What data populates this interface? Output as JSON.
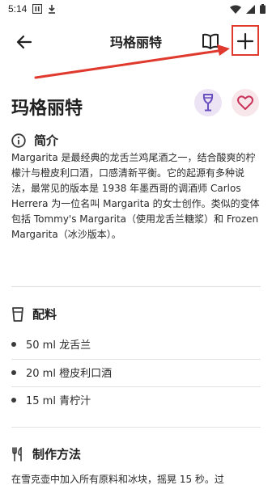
{
  "status_bar": {
    "time": "5:14"
  },
  "app_bar": {
    "title": "玛格丽特"
  },
  "header": {
    "name": "玛格丽特"
  },
  "intro": {
    "title": "简介",
    "text": "Margarita 是最经典的龙舌兰鸡尾酒之一，结合酸爽的柠檬汁与橙皮利口酒，口感清新平衡。它的起源有多种说法，最常见的版本是 1938 年墨西哥的调酒师 Carlos Herrera 为一位名叫 Margarita 的女士创作。类似的变体包括 Tommy's Margarita（使用龙舌兰糖浆）和 Frozen Margarita（冰沙版本）。"
  },
  "ingredients": {
    "title": "配料",
    "items": [
      "50 ml 龙舌兰",
      "20 ml 橙皮利口酒",
      "15 ml 青柠汁"
    ]
  },
  "method": {
    "title": "制作方法",
    "text": "在雪克壶中加入所有原料和冰块，摇晃 15 秒。过"
  },
  "colors": {
    "accent_purple": "#6a4fc0",
    "fav_red": "#c9335a",
    "highlight_red": "#e03a2f"
  }
}
